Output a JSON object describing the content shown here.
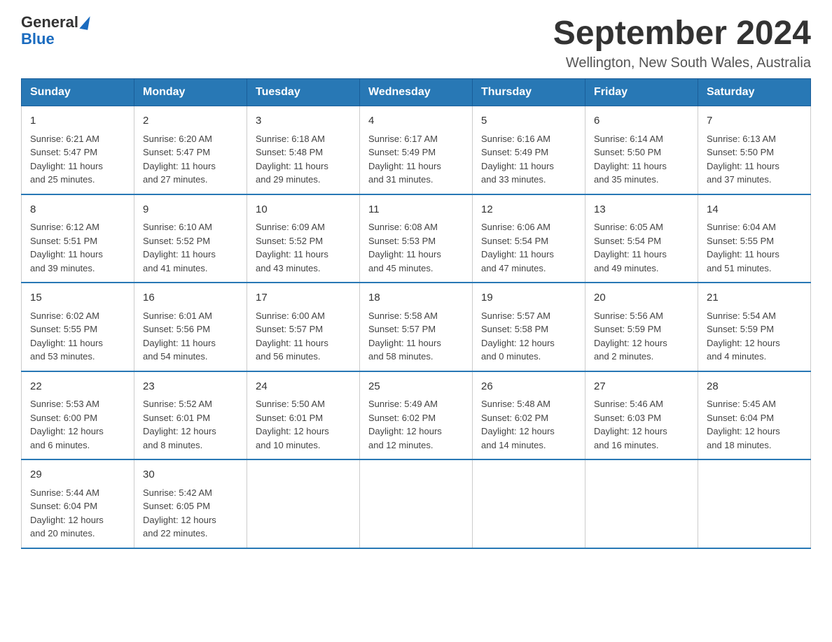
{
  "header": {
    "logo_general": "General",
    "logo_blue": "Blue",
    "month_year": "September 2024",
    "location": "Wellington, New South Wales, Australia"
  },
  "weekdays": [
    "Sunday",
    "Monday",
    "Tuesday",
    "Wednesday",
    "Thursday",
    "Friday",
    "Saturday"
  ],
  "weeks": [
    [
      {
        "day": "1",
        "sunrise": "6:21 AM",
        "sunset": "5:47 PM",
        "daylight": "11 hours and 25 minutes."
      },
      {
        "day": "2",
        "sunrise": "6:20 AM",
        "sunset": "5:47 PM",
        "daylight": "11 hours and 27 minutes."
      },
      {
        "day": "3",
        "sunrise": "6:18 AM",
        "sunset": "5:48 PM",
        "daylight": "11 hours and 29 minutes."
      },
      {
        "day": "4",
        "sunrise": "6:17 AM",
        "sunset": "5:49 PM",
        "daylight": "11 hours and 31 minutes."
      },
      {
        "day": "5",
        "sunrise": "6:16 AM",
        "sunset": "5:49 PM",
        "daylight": "11 hours and 33 minutes."
      },
      {
        "day": "6",
        "sunrise": "6:14 AM",
        "sunset": "5:50 PM",
        "daylight": "11 hours and 35 minutes."
      },
      {
        "day": "7",
        "sunrise": "6:13 AM",
        "sunset": "5:50 PM",
        "daylight": "11 hours and 37 minutes."
      }
    ],
    [
      {
        "day": "8",
        "sunrise": "6:12 AM",
        "sunset": "5:51 PM",
        "daylight": "11 hours and 39 minutes."
      },
      {
        "day": "9",
        "sunrise": "6:10 AM",
        "sunset": "5:52 PM",
        "daylight": "11 hours and 41 minutes."
      },
      {
        "day": "10",
        "sunrise": "6:09 AM",
        "sunset": "5:52 PM",
        "daylight": "11 hours and 43 minutes."
      },
      {
        "day": "11",
        "sunrise": "6:08 AM",
        "sunset": "5:53 PM",
        "daylight": "11 hours and 45 minutes."
      },
      {
        "day": "12",
        "sunrise": "6:06 AM",
        "sunset": "5:54 PM",
        "daylight": "11 hours and 47 minutes."
      },
      {
        "day": "13",
        "sunrise": "6:05 AM",
        "sunset": "5:54 PM",
        "daylight": "11 hours and 49 minutes."
      },
      {
        "day": "14",
        "sunrise": "6:04 AM",
        "sunset": "5:55 PM",
        "daylight": "11 hours and 51 minutes."
      }
    ],
    [
      {
        "day": "15",
        "sunrise": "6:02 AM",
        "sunset": "5:55 PM",
        "daylight": "11 hours and 53 minutes."
      },
      {
        "day": "16",
        "sunrise": "6:01 AM",
        "sunset": "5:56 PM",
        "daylight": "11 hours and 54 minutes."
      },
      {
        "day": "17",
        "sunrise": "6:00 AM",
        "sunset": "5:57 PM",
        "daylight": "11 hours and 56 minutes."
      },
      {
        "day": "18",
        "sunrise": "5:58 AM",
        "sunset": "5:57 PM",
        "daylight": "11 hours and 58 minutes."
      },
      {
        "day": "19",
        "sunrise": "5:57 AM",
        "sunset": "5:58 PM",
        "daylight": "12 hours and 0 minutes."
      },
      {
        "day": "20",
        "sunrise": "5:56 AM",
        "sunset": "5:59 PM",
        "daylight": "12 hours and 2 minutes."
      },
      {
        "day": "21",
        "sunrise": "5:54 AM",
        "sunset": "5:59 PM",
        "daylight": "12 hours and 4 minutes."
      }
    ],
    [
      {
        "day": "22",
        "sunrise": "5:53 AM",
        "sunset": "6:00 PM",
        "daylight": "12 hours and 6 minutes."
      },
      {
        "day": "23",
        "sunrise": "5:52 AM",
        "sunset": "6:01 PM",
        "daylight": "12 hours and 8 minutes."
      },
      {
        "day": "24",
        "sunrise": "5:50 AM",
        "sunset": "6:01 PM",
        "daylight": "12 hours and 10 minutes."
      },
      {
        "day": "25",
        "sunrise": "5:49 AM",
        "sunset": "6:02 PM",
        "daylight": "12 hours and 12 minutes."
      },
      {
        "day": "26",
        "sunrise": "5:48 AM",
        "sunset": "6:02 PM",
        "daylight": "12 hours and 14 minutes."
      },
      {
        "day": "27",
        "sunrise": "5:46 AM",
        "sunset": "6:03 PM",
        "daylight": "12 hours and 16 minutes."
      },
      {
        "day": "28",
        "sunrise": "5:45 AM",
        "sunset": "6:04 PM",
        "daylight": "12 hours and 18 minutes."
      }
    ],
    [
      {
        "day": "29",
        "sunrise": "5:44 AM",
        "sunset": "6:04 PM",
        "daylight": "12 hours and 20 minutes."
      },
      {
        "day": "30",
        "sunrise": "5:42 AM",
        "sunset": "6:05 PM",
        "daylight": "12 hours and 22 minutes."
      },
      null,
      null,
      null,
      null,
      null
    ]
  ],
  "labels": {
    "sunrise": "Sunrise:",
    "sunset": "Sunset:",
    "daylight": "Daylight:"
  }
}
